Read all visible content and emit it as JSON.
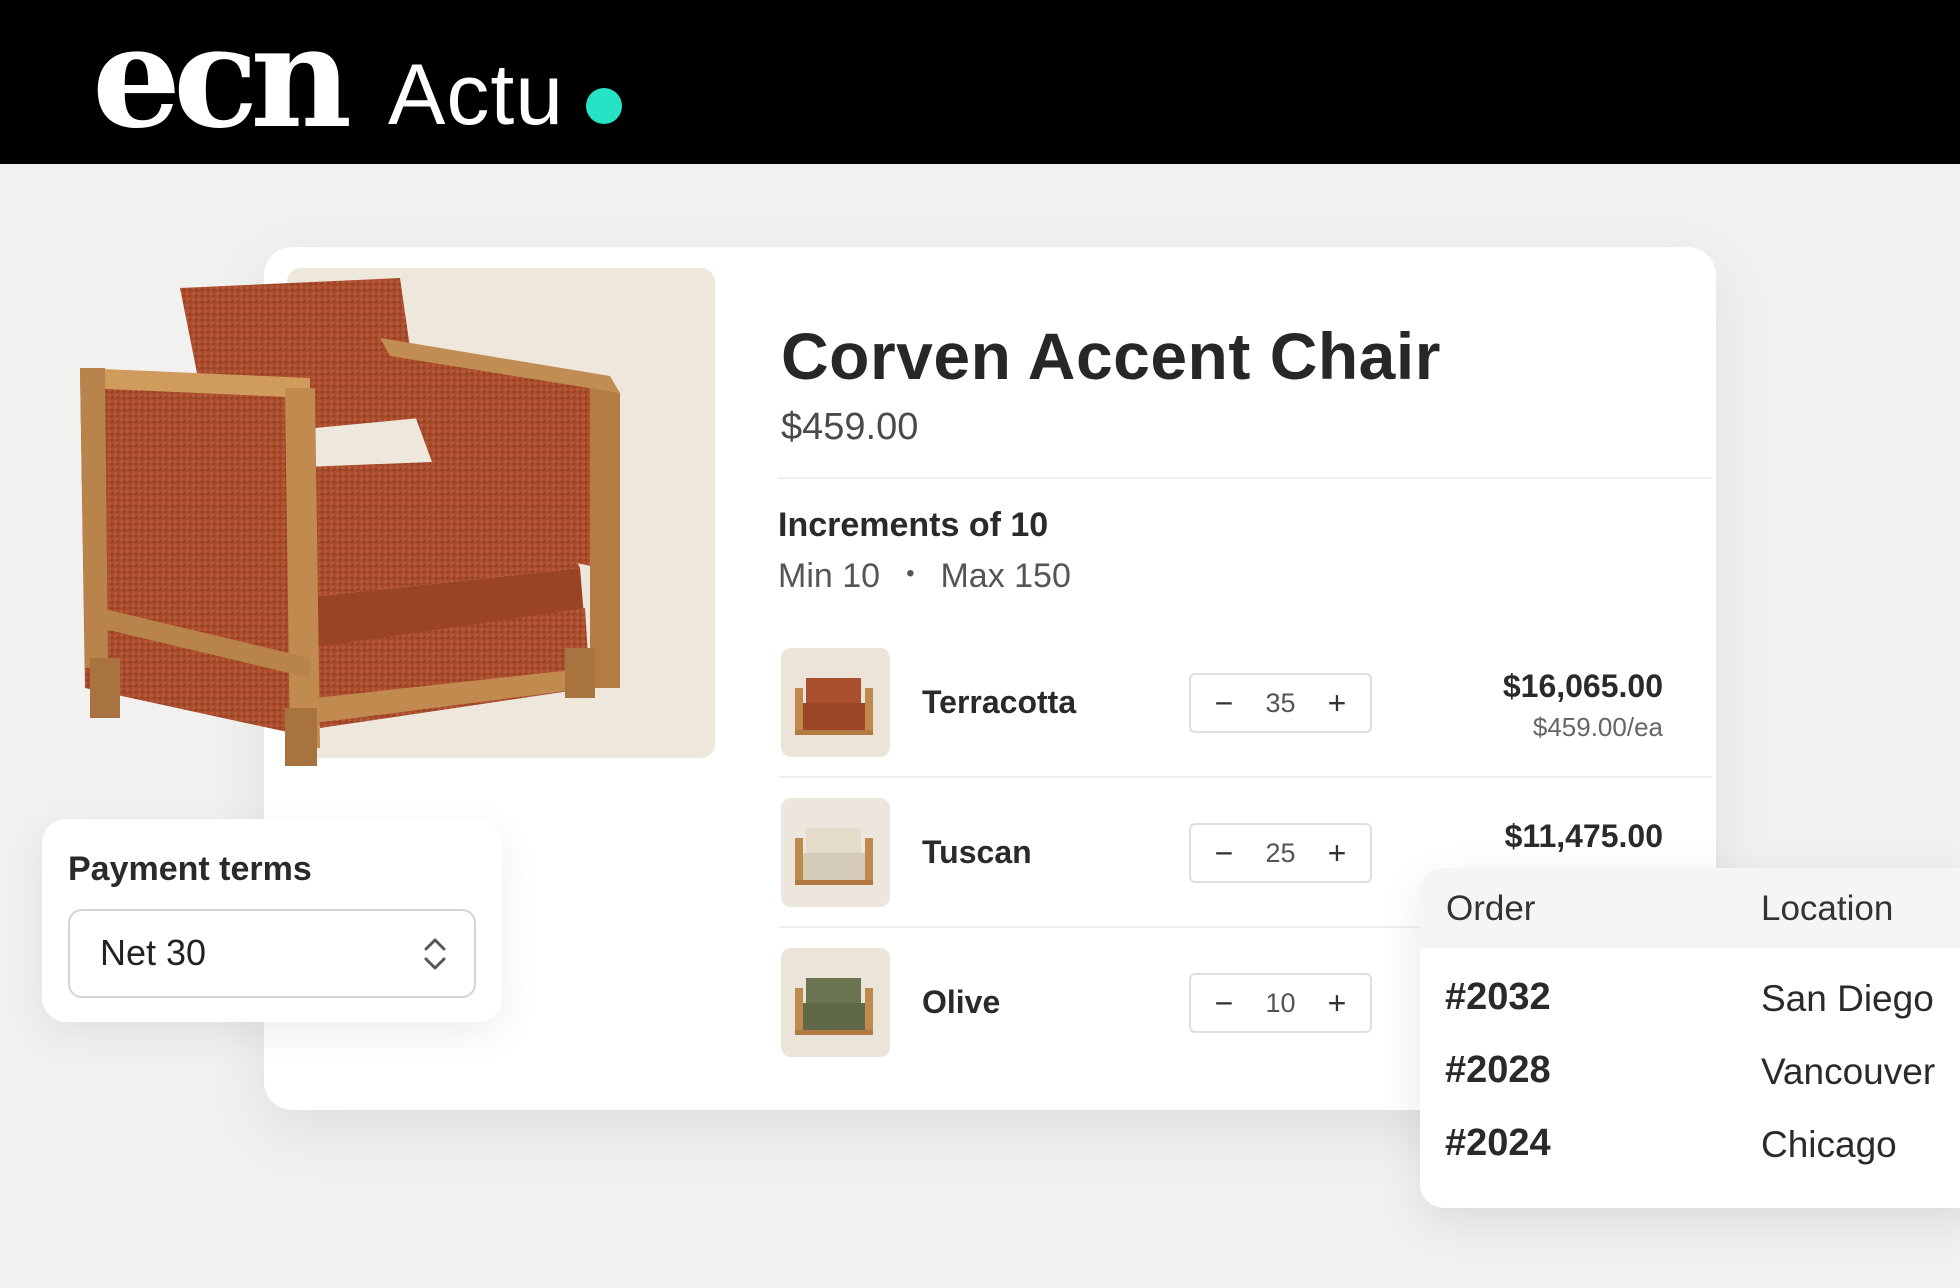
{
  "brand": {
    "logo_text": "ecn",
    "section": "Actu",
    "accent_color": "#26e3c6"
  },
  "product": {
    "title": "Corven Accent Chair",
    "price": "$459.00",
    "increments_title": "Increments of 10",
    "min_label": "Min 10",
    "separator": "•",
    "max_label": "Max 150"
  },
  "variants": [
    {
      "name": "Terracotta",
      "quantity": "35",
      "total": "$16,065.00",
      "unit_price": "$459.00/ea",
      "color": "#a9502f"
    },
    {
      "name": "Tuscan",
      "quantity": "25",
      "total": "$11,475.00",
      "unit_price": "",
      "color": "#ddd3c2"
    },
    {
      "name": "Olive",
      "quantity": "10",
      "total": "",
      "unit_price": "",
      "color": "#6b7451"
    }
  ],
  "stepper": {
    "decrement": "−",
    "increment": "+"
  },
  "payment": {
    "label": "Payment terms",
    "value": "Net 30"
  },
  "orders": {
    "headers": {
      "order": "Order",
      "location": "Location"
    },
    "rows": [
      {
        "number": "#2032",
        "location": "San Diego"
      },
      {
        "number": "#2028",
        "location": "Vancouver"
      },
      {
        "number": "#2024",
        "location": "Chicago"
      }
    ]
  }
}
